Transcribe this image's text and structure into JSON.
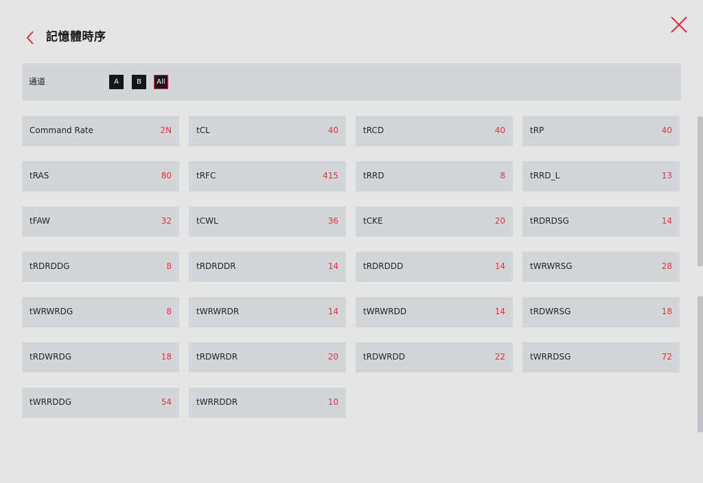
{
  "header": {
    "title": "記憶體時序",
    "back_icon": "chevron-left-icon",
    "close_icon": "close-icon",
    "accent_color": "#e8273a"
  },
  "channel": {
    "label": "通道",
    "options": [
      "A",
      "B",
      "All"
    ],
    "selected": "All"
  },
  "timings": [
    {
      "label": "Command Rate",
      "value": "2N"
    },
    {
      "label": "tCL",
      "value": "40"
    },
    {
      "label": "tRCD",
      "value": "40"
    },
    {
      "label": "tRP",
      "value": "40"
    },
    {
      "label": "tRAS",
      "value": "80"
    },
    {
      "label": "tRFC",
      "value": "415"
    },
    {
      "label": "tRRD",
      "value": "8"
    },
    {
      "label": "tRRD_L",
      "value": "13"
    },
    {
      "label": "tFAW",
      "value": "32"
    },
    {
      "label": "tCWL",
      "value": "36"
    },
    {
      "label": "tCKE",
      "value": "20"
    },
    {
      "label": "tRDRDSG",
      "value": "14"
    },
    {
      "label": "tRDRDDG",
      "value": "8"
    },
    {
      "label": "tRDRDDR",
      "value": "14"
    },
    {
      "label": "tRDRDDD",
      "value": "14"
    },
    {
      "label": "tWRWRSG",
      "value": "28"
    },
    {
      "label": "tWRWRDG",
      "value": "8"
    },
    {
      "label": "tWRWRDR",
      "value": "14"
    },
    {
      "label": "tWRWRDD",
      "value": "14"
    },
    {
      "label": "tRDWRSG",
      "value": "18"
    },
    {
      "label": "tRDWRDG",
      "value": "18"
    },
    {
      "label": "tRDWRDR",
      "value": "20"
    },
    {
      "label": "tRDWRDD",
      "value": "22"
    },
    {
      "label": "tWRRDSG",
      "value": "72"
    },
    {
      "label": "tWRRDDG",
      "value": "54"
    },
    {
      "label": "tWRRDDR",
      "value": "10"
    }
  ]
}
